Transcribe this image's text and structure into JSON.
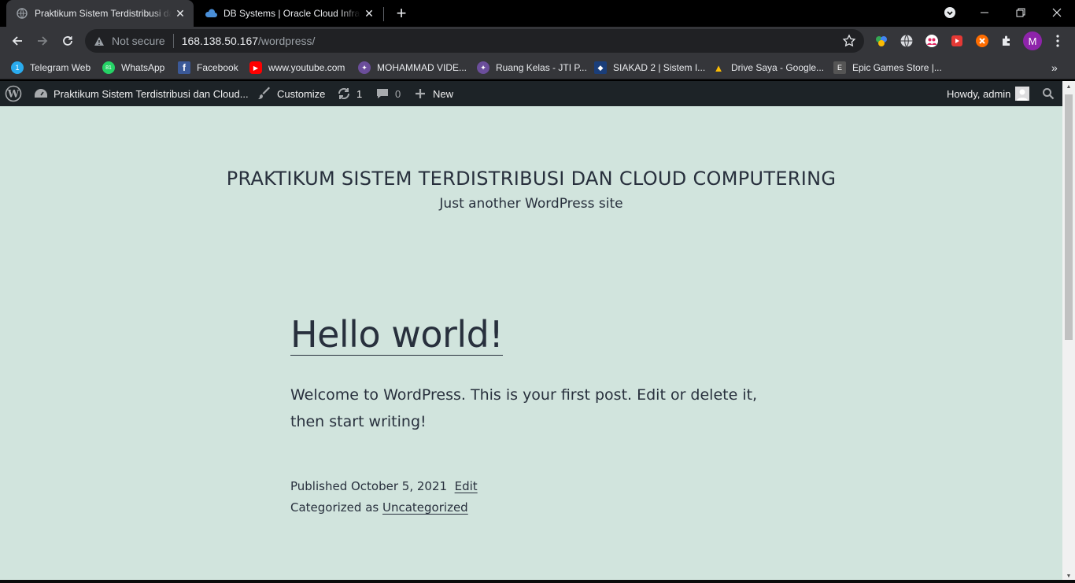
{
  "browser": {
    "tabs": [
      {
        "title": "Praktikum Sistem Terdistribusi dan Cloud Computering",
        "active": true
      },
      {
        "title": "DB Systems | Oracle Cloud Infrastructure",
        "active": false
      }
    ],
    "security_label": "Not secure",
    "url_host": "168.138.50.167",
    "url_path": "/wordpress/",
    "profile_initial": "M"
  },
  "bookmarks": [
    {
      "label": "Telegram Web",
      "color": "#2aabee",
      "glyph": "1"
    },
    {
      "label": "WhatsApp",
      "color": "#25d366",
      "glyph": "81"
    },
    {
      "label": "Facebook",
      "color": "#3b5998",
      "glyph": "f"
    },
    {
      "label": "www.youtube.com",
      "color": "#ff0000",
      "glyph": "▶"
    },
    {
      "label": "MOHAMMAD VIDE...",
      "color": "#6b4e9b",
      "glyph": "✦"
    },
    {
      "label": "Ruang Kelas - JTI P...",
      "color": "#6b4e9b",
      "glyph": "✦"
    },
    {
      "label": "SIAKAD 2 | Sistem I...",
      "color": "#1a3e7a",
      "glyph": "◆"
    },
    {
      "label": "Drive Saya - Google...",
      "color": "#fbbc04",
      "glyph": "▲"
    },
    {
      "label": "Epic Games Store |...",
      "color": "#555555",
      "glyph": "E"
    }
  ],
  "adminbar": {
    "site_name": "Praktikum Sistem Terdistribusi dan Cloud...",
    "customize": "Customize",
    "updates_count": "1",
    "comments_count": "0",
    "new": "New",
    "howdy": "Howdy, admin"
  },
  "site": {
    "title": "PRAKTIKUM SISTEM TERDISTRIBUSI DAN CLOUD COMPUTERING",
    "description": "Just another WordPress site"
  },
  "post": {
    "title": "Hello world!",
    "content": "Welcome to WordPress. This is your first post. Edit or delete it, then start writing!",
    "published_prefix": "Published",
    "published_date": "October 5, 2021",
    "edit_label": "Edit",
    "categorized_prefix": "Categorized as",
    "category": "Uncategorized"
  },
  "colors": {
    "page_bg": "#d1e4dd",
    "text": "#28303d",
    "adminbar_bg": "#1d2327",
    "chrome_bg": "#35363a"
  }
}
